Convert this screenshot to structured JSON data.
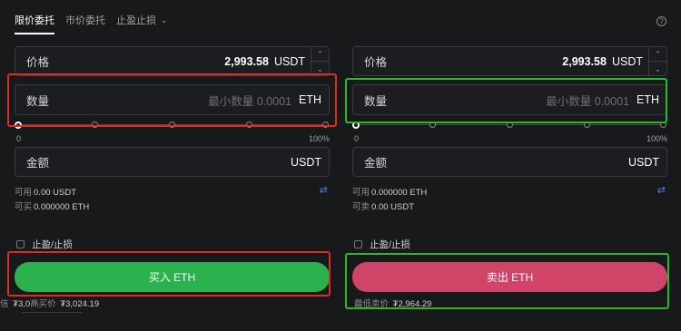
{
  "tabs": [
    {
      "label": "限价委托",
      "active": true
    },
    {
      "label": "市价委托",
      "active": false
    },
    {
      "label": "止盈止损",
      "active": false
    }
  ],
  "help_icon": "?",
  "buy": {
    "price_label": "价格",
    "price_value": "2,993.58",
    "price_unit": "USDT",
    "qty_label": "数量",
    "qty_placeholder": "最小数量 0.0001",
    "qty_unit": "ETH",
    "slider_min": "0",
    "slider_max": "100%",
    "amount_label": "金额",
    "amount_unit": "USDT",
    "avail_label": "可用",
    "avail_value": "0.00 USDT",
    "can_label": "可买",
    "can_value": "0.000000 ETH",
    "tpsl_label": "止盈/止损",
    "button_label": "买入 ETH",
    "bottom_label": "信",
    "bottom_value1": "₮3,0",
    "bottom_label2": "高买价",
    "bottom_value2": "₮3,024.19"
  },
  "sell": {
    "price_label": "价格",
    "price_value": "2,993.58",
    "price_unit": "USDT",
    "qty_label": "数量",
    "qty_placeholder": "最小数量 0.0001",
    "qty_unit": "ETH",
    "slider_min": "0",
    "slider_max": "100%",
    "amount_label": "金额",
    "amount_unit": "USDT",
    "avail_label": "可用",
    "avail_value": "0.000000 ETH",
    "can_label": "可卖",
    "can_value": "0.00 USDT",
    "tpsl_label": "止盈/止损",
    "button_label": "卖出 ETH",
    "bottom_label": "最低卖价",
    "bottom_value": "₮2,964.29"
  },
  "colors": {
    "background": "#18191b",
    "buy": "#2bb14d",
    "sell": "#d04468",
    "highlight_red": "#e12b21",
    "highlight_green": "#2cb82c",
    "swap_icon": "#4b7bec"
  }
}
